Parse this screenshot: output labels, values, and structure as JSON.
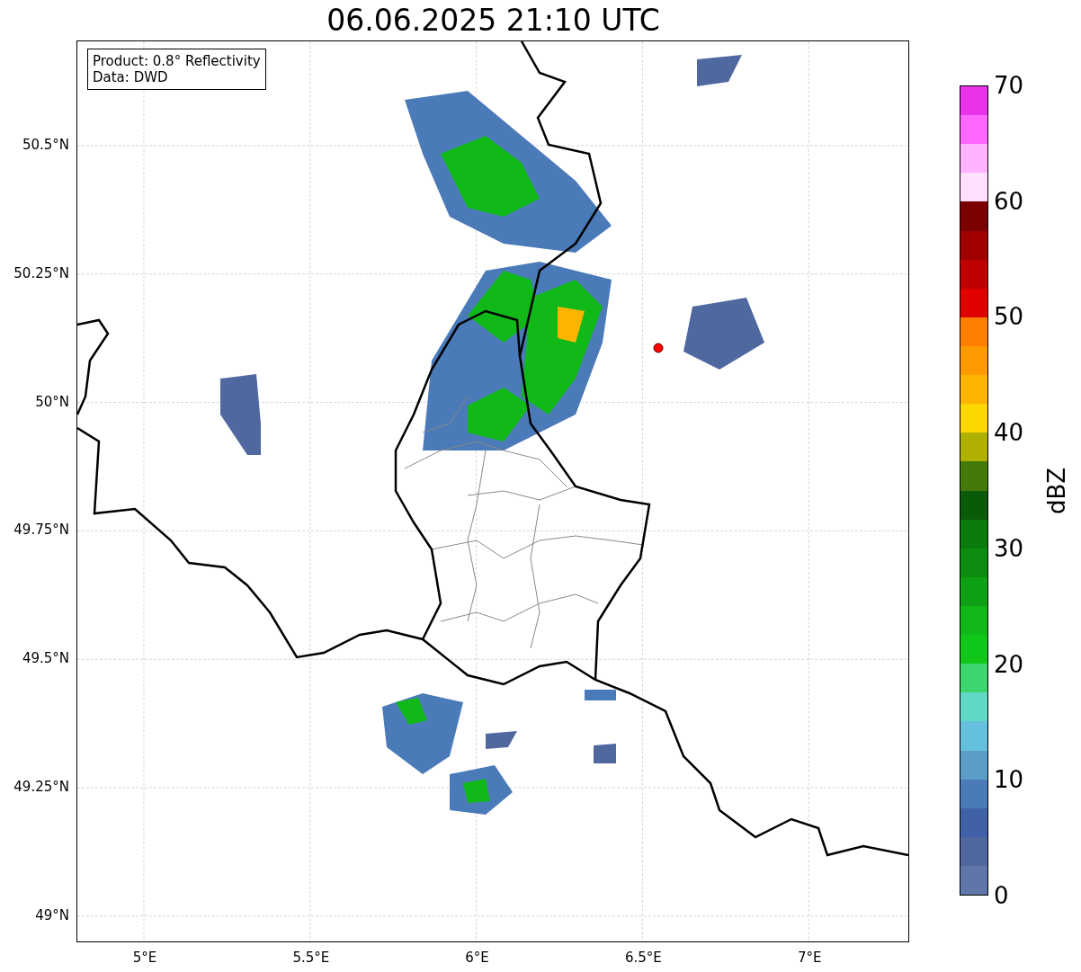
{
  "title": "06.06.2025 21:10 UTC",
  "info_box": [
    "Product: 0.8° Reflectivity",
    "Data: DWD"
  ],
  "y_ticks": [
    "50.5°N",
    "50.25°N",
    "50°N",
    "49.75°N",
    "49.5°N",
    "49.25°N",
    "49°N"
  ],
  "x_ticks": [
    "5°E",
    "5.5°E",
    "6°E",
    "6.5°E",
    "7°E"
  ],
  "colorbar": {
    "label": "dBZ",
    "ticks": [
      "70",
      "60",
      "50",
      "40",
      "30",
      "20",
      "10",
      "0"
    ],
    "bands": [
      {
        "color": "#e833e8"
      },
      {
        "color": "#ff66ff"
      },
      {
        "color": "#ffb3ff"
      },
      {
        "color": "#ffe0ff"
      },
      {
        "color": "#7a0000"
      },
      {
        "color": "#a00000"
      },
      {
        "color": "#c00000"
      },
      {
        "color": "#e00000"
      },
      {
        "color": "#ff8000"
      },
      {
        "color": "#ff9a00"
      },
      {
        "color": "#ffb400"
      },
      {
        "color": "#ffd700"
      },
      {
        "color": "#b0b000"
      },
      {
        "color": "#447a0a"
      },
      {
        "color": "#0a5a0a"
      },
      {
        "color": "#0a7a0a"
      },
      {
        "color": "#0c8c10"
      },
      {
        "color": "#0ea015"
      },
      {
        "color": "#10b818"
      },
      {
        "color": "#10c81a"
      },
      {
        "color": "#3dd66e"
      },
      {
        "color": "#5fd9c5"
      },
      {
        "color": "#64c0dd"
      },
      {
        "color": "#5a9ec8"
      },
      {
        "color": "#4a7ab8"
      },
      {
        "color": "#4060a8"
      },
      {
        "color": "#5068a0"
      },
      {
        "color": "#6075a8"
      }
    ]
  }
}
